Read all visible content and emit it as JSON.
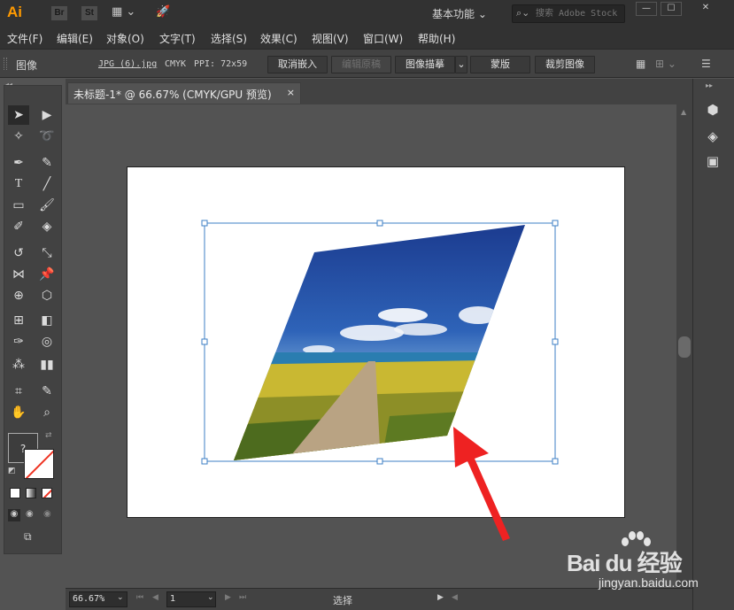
{
  "app": {
    "logo": "Ai",
    "bridge": "Br",
    "stock": "St",
    "workspace": "基本功能",
    "search_placeholder": "搜索 Adobe Stock"
  },
  "menu": [
    "文件(F)",
    "编辑(E)",
    "对象(O)",
    "文字(T)",
    "选择(S)",
    "效果(C)",
    "视图(V)",
    "窗口(W)",
    "帮助(H)"
  ],
  "control": {
    "type_label": "图像",
    "filename": "JPG (6).jpg",
    "color_mode": "CMYK",
    "ppi": "PPI: 72x59",
    "unembed": "取消嵌入",
    "edit_original": "编辑原稿",
    "image_trace": "图像描摹",
    "mask": "蒙版",
    "crop": "裁剪图像"
  },
  "document": {
    "tab_title": "未标题-1* @ 66.67% (CMYK/GPU 预览)",
    "close": "×"
  },
  "status": {
    "zoom": "66.67%",
    "page": "1",
    "tool": "选择"
  },
  "watermark": {
    "main": "Bai du 经验",
    "sub": "jingyan.baidu.com"
  },
  "colors": {
    "annotation_arrow": "#ee2222",
    "selection": "#3d7fc4"
  }
}
